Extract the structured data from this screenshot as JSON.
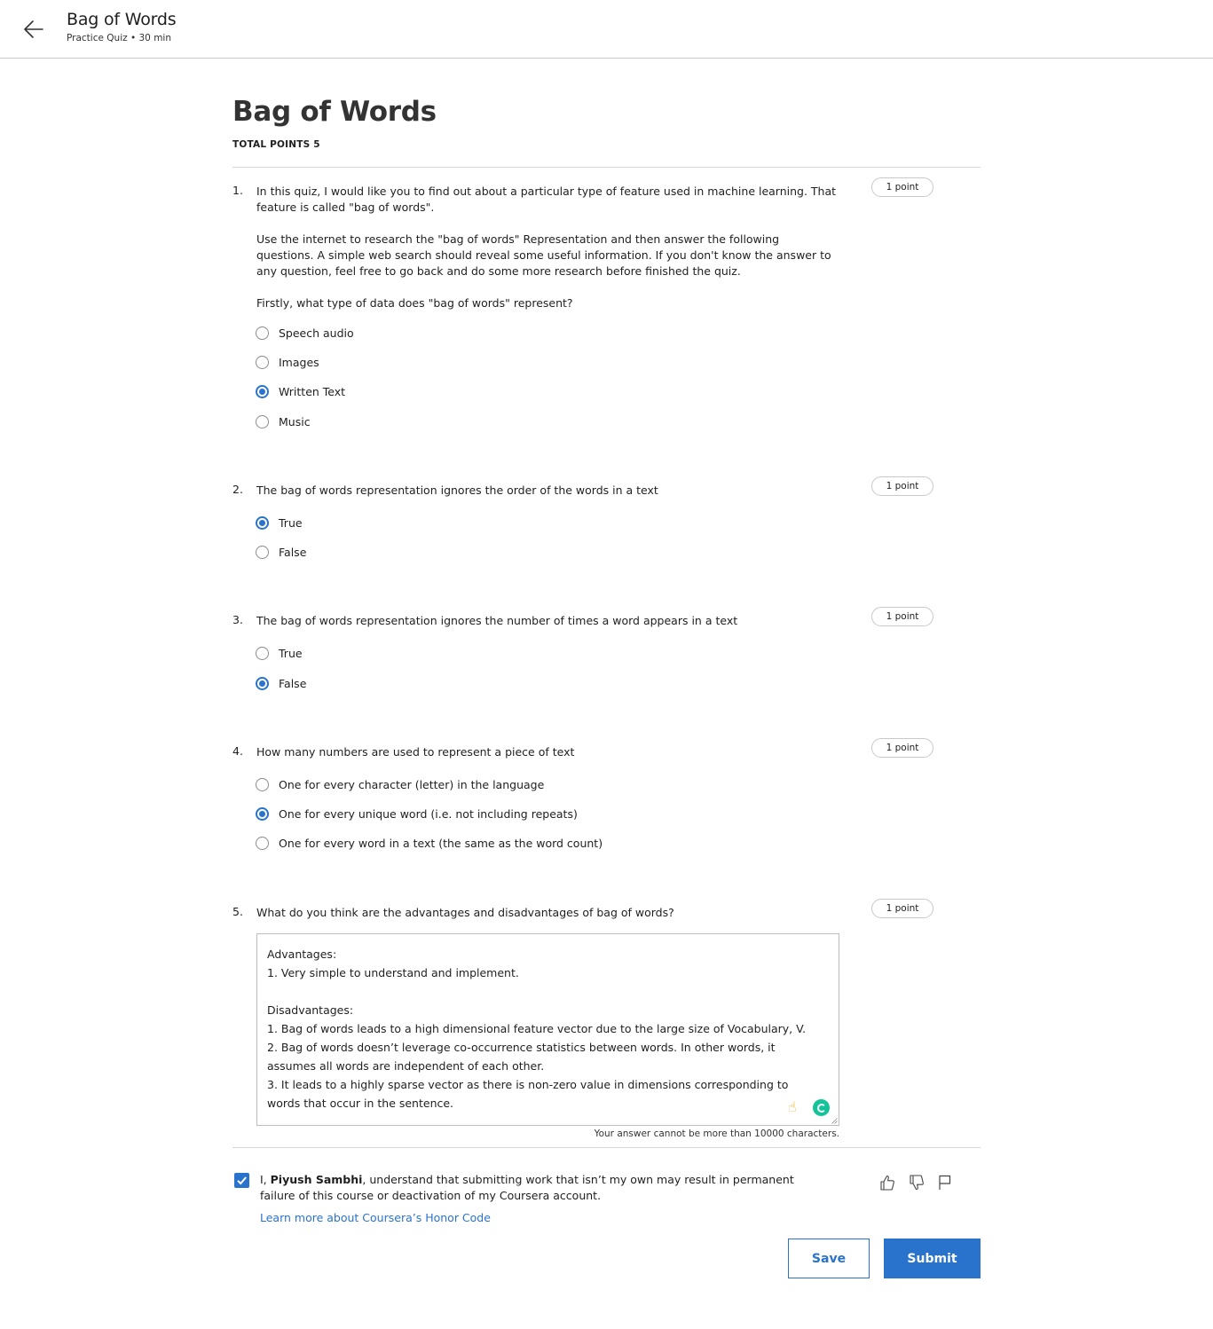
{
  "header": {
    "title": "Bag of Words",
    "subtitle": "Practice Quiz • 30 min"
  },
  "main": {
    "title": "Bag of Words",
    "total_points": "TOTAL POINTS 5"
  },
  "questions": [
    {
      "number": "1.",
      "paragraphs": [
        "In this quiz, I would like you to find out about a particular type of feature used in machine learning. That feature is called \"bag of words\".",
        "Use the internet to research the \"bag of words\" Representation and then answer the following questions. A simple web search should reveal some useful information. If you don't know the answer to any question, feel free to go back and do some more research before finished the quiz.",
        "Firstly, what type of data does \"bag of words\" represent?"
      ],
      "points": "1 point",
      "options": [
        "Speech audio",
        "Images",
        "Written Text",
        "Music"
      ],
      "selected": "Written Text"
    },
    {
      "number": "2.",
      "paragraphs": [
        "The bag of words representation ignores the order of the words in a text"
      ],
      "points": "1 point",
      "options": [
        "True",
        "False"
      ],
      "selected": "True"
    },
    {
      "number": "3.",
      "paragraphs": [
        "The bag of words representation ignores the number of times a word appears in a text"
      ],
      "points": "1 point",
      "options": [
        "True",
        "False"
      ],
      "selected": "False"
    },
    {
      "number": "4.",
      "paragraphs": [
        "How many numbers are used to represent a piece of text"
      ],
      "points": "1 point",
      "options": [
        "One for every character (letter) in the language",
        "One for every unique word (i.e. not including repeats)",
        "One for every word in a text (the same as the word count)"
      ],
      "selected": "One for every unique word (i.e. not including repeats)"
    },
    {
      "number": "5.",
      "paragraphs": [
        "What do you think are the advantages and disadvantages of bag of words?"
      ],
      "points": "1 point",
      "answer": "Advantages:\n1. Very simple to understand and implement.\n\nDisadvantages:\n1. Bag of words leads to a high dimensional feature vector due to the large size of Vocabulary, V.\n2. Bag of words doesn’t leverage co-occurrence statistics between words. In other words, it assumes all words are independent of each other.\n3. It leads to a highly sparse vector as there is non-zero value in dimensions corresponding to words that occur in the sentence.",
      "char_limit_note": "Your answer cannot be more than 10000 characters."
    }
  ],
  "honor": {
    "checked": true,
    "prefix": "I, ",
    "name": "Piyush Sambhi",
    "suffix": ", understand that submitting work that isn’t my own may result in permanent failure of this course or deactivation of my Coursera account.",
    "link": "Learn more about Coursera’s Honor Code"
  },
  "feedback_icons": [
    "thumbs-up-icon",
    "thumbs-down-icon",
    "flag-icon"
  ],
  "actions": {
    "save": "Save",
    "submit": "Submit"
  },
  "colors": {
    "accent": "#2a73cc",
    "grammarly": "#15c39a"
  }
}
